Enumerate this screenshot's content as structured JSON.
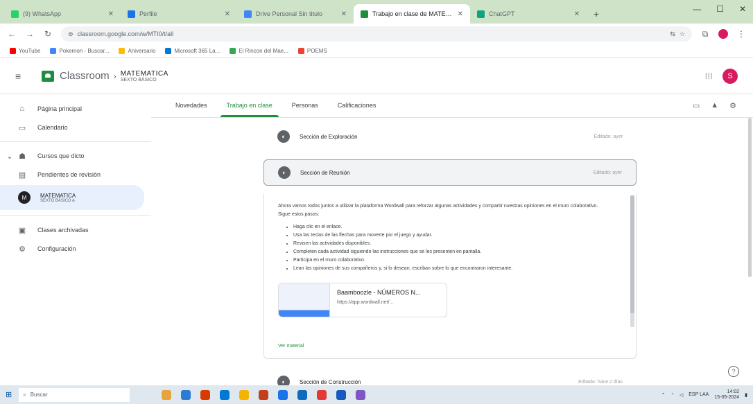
{
  "browser": {
    "tabs": [
      {
        "label": "(9) WhatsApp",
        "color": "#25d366",
        "active": false
      },
      {
        "label": "Perfile",
        "color": "#1a73e8",
        "active": false
      },
      {
        "label": "Drive Personal Sin titulo",
        "color": "#4285f4",
        "active": false
      },
      {
        "label": "Trabajo en clase de MATEMATI",
        "color": "#1e8e3e",
        "active": true
      },
      {
        "label": "ChatGPT",
        "color": "#10a37f",
        "active": false
      }
    ],
    "newtab": "+",
    "address": "classroom.google.com/w/MTI0/t/all",
    "bookmarks": [
      {
        "label": "YouTube",
        "color": "#ff0000"
      },
      {
        "label": "Pokemon - Buscar...",
        "color": "#4285f4"
      },
      {
        "label": "Aniversario",
        "color": "#fbbc04"
      },
      {
        "label": "Microsoft 365 La...",
        "color": "#0078d4"
      },
      {
        "label": "El Rincon del Mae...",
        "color": "#34a853"
      },
      {
        "label": "POEMS",
        "color": "#ea4335"
      }
    ]
  },
  "header": {
    "app_name": "Classroom",
    "course_title": "MATEMATICA",
    "course_subtitle": "SEXTO BÁSICO",
    "avatar_letter": "S"
  },
  "sidebar": {
    "items": [
      {
        "icon": "home-icon",
        "glyph": "⌂",
        "label": "Página principal"
      },
      {
        "icon": "calendar-icon",
        "glyph": "▭",
        "label": "Calendario"
      }
    ],
    "teaching_label": "Cursos que dicto",
    "todo_label": "Pendientes de revisión",
    "course": {
      "letter": "M",
      "title": "MATEMATICA",
      "subtitle": "SEXTO BÁSICO A"
    },
    "archived_label": "Clases archivadas",
    "settings_label": "Configuración"
  },
  "tabs": [
    {
      "label": "Novedades",
      "active": false
    },
    {
      "label": "Trabajo en clase",
      "active": true
    },
    {
      "label": "Personas",
      "active": false
    },
    {
      "label": "Calificaciones",
      "active": false
    }
  ],
  "sections": {
    "exploracion": {
      "name": "Sección de Exploración",
      "date": "Editado: ayer"
    },
    "reunion": {
      "name": "Sección de Reunión",
      "date": "Editado: ayer"
    },
    "construccion": {
      "name": "Sección de Construcción",
      "date": "Editado: hace 2 días"
    }
  },
  "reunion_details": {
    "description": "Ahora vamos todos juntos a utilizar la plataforma Wordwall para reforzar algunas actividades y compartir nuestras opiniones en el muro colaborativo. Sigue estos pasos:",
    "bullets": [
      "Haga clic en el enlace.",
      "Usa las teclas de las flechas para moverte por el juego y ayudar.",
      "Revisen las actividades disponibles.",
      "Completen cada actividad siguiendo las instrucciones que se les presenten en pantalla.",
      "Participa en el muro colaborativo.",
      "Lean las opiniones de sus compañeros y, si lo desean, escriban sobre lo que encontraron interesante."
    ],
    "attachment": {
      "title": "Baamboozle - NÚMEROS N...",
      "url": "https://app.wordwall.net/..."
    },
    "see_more": "Ver material"
  },
  "taskbar": {
    "search_placeholder": "Buscar",
    "time": "14:02",
    "date": "15-05-2024",
    "tray_text": "ESP LAA"
  }
}
